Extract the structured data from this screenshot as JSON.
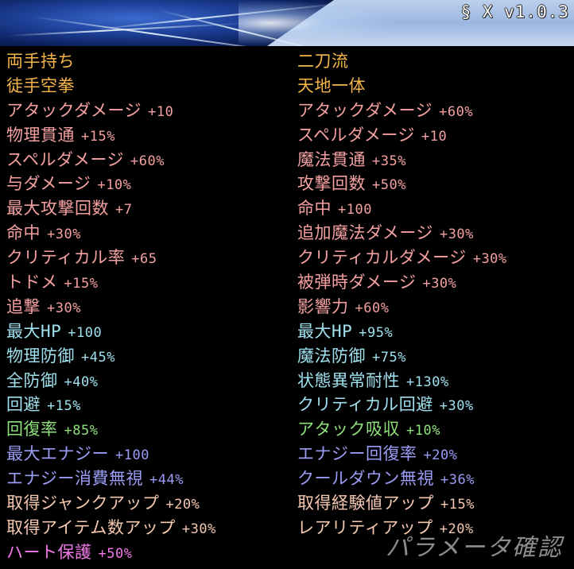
{
  "header": {
    "version": "§ X v1.0.3"
  },
  "colors": {
    "title": "#f5b54a",
    "attack": "#f5a0a0",
    "defense": "#9fe0ee",
    "recovery": "#8ee07a",
    "energy": "#9a9cf5",
    "acquire": "#f5c8b0",
    "heart": "#f07ae8"
  },
  "left": [
    {
      "label": "両手持ち",
      "value": "",
      "color": "title"
    },
    {
      "label": "徒手空拳",
      "value": "",
      "color": "title"
    },
    {
      "label": "アタックダメージ",
      "value": "+10",
      "color": "attack"
    },
    {
      "label": "物理貫通",
      "value": "+15%",
      "color": "attack"
    },
    {
      "label": "スペルダメージ",
      "value": "+60%",
      "color": "attack"
    },
    {
      "label": "与ダメージ",
      "value": "+10%",
      "color": "attack"
    },
    {
      "label": "最大攻撃回数",
      "value": "+7",
      "color": "attack"
    },
    {
      "label": "命中",
      "value": "+30%",
      "color": "attack"
    },
    {
      "label": "クリティカル率",
      "value": "+65",
      "color": "attack"
    },
    {
      "label": "トドメ",
      "value": "+15%",
      "color": "attack"
    },
    {
      "label": "追撃",
      "value": "+30%",
      "color": "attack"
    },
    {
      "label": "最大HP",
      "value": "+100",
      "color": "defense"
    },
    {
      "label": "物理防御",
      "value": "+45%",
      "color": "defense"
    },
    {
      "label": "全防御",
      "value": "+40%",
      "color": "defense"
    },
    {
      "label": "回避",
      "value": "+15%",
      "color": "defense"
    },
    {
      "label": "回復率",
      "value": "+85%",
      "color": "recovery"
    },
    {
      "label": "最大エナジー",
      "value": "+100",
      "color": "energy"
    },
    {
      "label": "エナジー消費無視",
      "value": "+44%",
      "color": "energy"
    },
    {
      "label": "取得ジャンクアップ",
      "value": "+20%",
      "color": "acquire"
    },
    {
      "label": "取得アイテム数アップ",
      "value": "+30%",
      "color": "acquire"
    },
    {
      "label": "ハート保護",
      "value": "+50%",
      "color": "heart"
    }
  ],
  "right": [
    {
      "label": "二刀流",
      "value": "",
      "color": "title"
    },
    {
      "label": "天地一体",
      "value": "",
      "color": "title"
    },
    {
      "label": "アタックダメージ",
      "value": "+60%",
      "color": "attack"
    },
    {
      "label": "スペルダメージ",
      "value": "+10",
      "color": "attack"
    },
    {
      "label": "魔法貫通",
      "value": "+35%",
      "color": "attack"
    },
    {
      "label": "攻撃回数",
      "value": "+50%",
      "color": "attack"
    },
    {
      "label": "命中",
      "value": "+100",
      "color": "attack"
    },
    {
      "label": "追加魔法ダメージ",
      "value": "+30%",
      "color": "attack"
    },
    {
      "label": "クリティカルダメージ",
      "value": "+30%",
      "color": "attack"
    },
    {
      "label": "被弾時ダメージ",
      "value": "+30%",
      "color": "attack"
    },
    {
      "label": "影響力",
      "value": "+60%",
      "color": "attack"
    },
    {
      "label": "最大HP",
      "value": "+95%",
      "color": "defense"
    },
    {
      "label": "魔法防御",
      "value": "+75%",
      "color": "defense"
    },
    {
      "label": "状態異常耐性",
      "value": "+130%",
      "color": "defense"
    },
    {
      "label": "クリティカル回避",
      "value": "+30%",
      "color": "defense"
    },
    {
      "label": "アタック吸収",
      "value": "+10%",
      "color": "recovery"
    },
    {
      "label": "エナジー回復率",
      "value": "+20%",
      "color": "energy"
    },
    {
      "label": "クールダウン無視",
      "value": "+36%",
      "color": "energy"
    },
    {
      "label": "取得経験値アップ",
      "value": "+15%",
      "color": "acquire"
    },
    {
      "label": "レアリティアップ",
      "value": "+20%",
      "color": "acquire"
    }
  ],
  "watermark": "パラメータ確認"
}
